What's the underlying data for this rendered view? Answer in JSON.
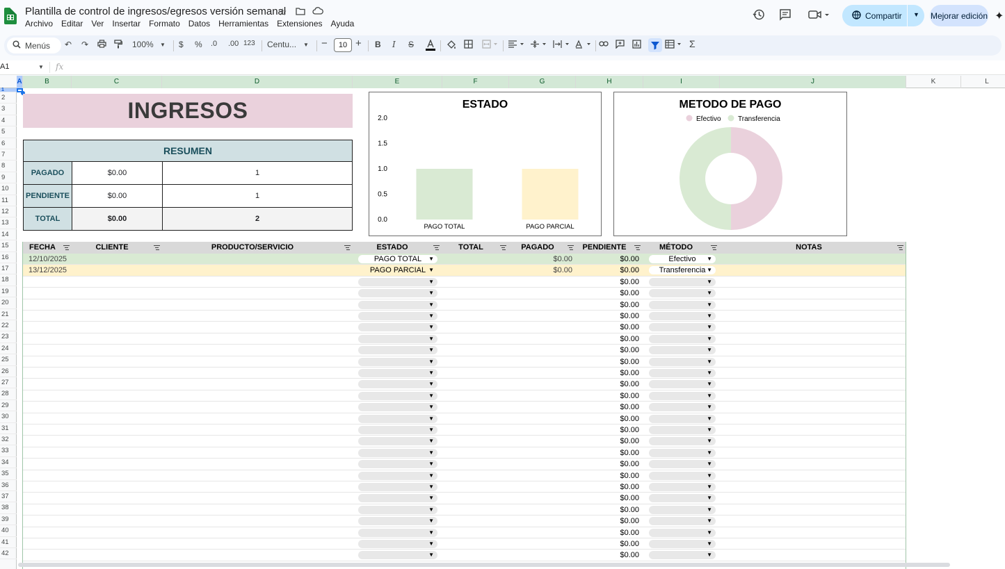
{
  "document": {
    "title": "Plantilla de control de ingresos/egresos versión semanal",
    "menu": [
      "Archivo",
      "Editar",
      "Ver",
      "Insertar",
      "Formato",
      "Datos",
      "Herramientas",
      "Extensiones",
      "Ayuda"
    ],
    "share_label": "Compartir",
    "upgrade_label": "Mejorar edición"
  },
  "toolbar": {
    "search_label": "Menús",
    "zoom": "100%",
    "currency": "$",
    "percent": "%",
    "decimal_less": ".0",
    "decimal_more": ".00",
    "number_format": "123",
    "font": "Centu...",
    "font_size": "10"
  },
  "formula_bar": {
    "cell_ref": "A1",
    "fx": "fx"
  },
  "columns": [
    "A",
    "B",
    "C",
    "D",
    "E",
    "F",
    "G",
    "H",
    "I",
    "J",
    "K",
    "L"
  ],
  "rows": [
    "1",
    "2",
    "3",
    "4",
    "5",
    "6",
    "7",
    "8",
    "9",
    "10",
    "11",
    "12",
    "13",
    "14",
    "15",
    "16",
    "17",
    "18",
    "19",
    "20",
    "21",
    "22",
    "23",
    "24",
    "25",
    "26",
    "27",
    "28",
    "29",
    "30",
    "31",
    "32",
    "33",
    "34",
    "35",
    "36",
    "37",
    "38",
    "39",
    "40",
    "41",
    "42"
  ],
  "sheet": {
    "banner": "INGRESOS",
    "resumen": {
      "title": "RESUMEN",
      "rows": [
        {
          "label": "PAGADO",
          "amount": "$0.00",
          "count": "1"
        },
        {
          "label": "PENDIENTE",
          "amount": "$0.00",
          "count": "1"
        },
        {
          "label": "TOTAL",
          "amount": "$0.00",
          "count": "2"
        }
      ]
    },
    "table": {
      "headers": [
        "FECHA",
        "CLIENTE",
        "PRODUCTO/SERVICIO",
        "ESTADO",
        "TOTAL",
        "PAGADO",
        "PENDIENTE",
        "MÉTODO",
        "NOTAS"
      ],
      "rows": [
        {
          "fecha": "12/10/2025",
          "estado": "PAGO TOTAL",
          "pagado": "$0.00",
          "pendiente": "$0.00",
          "metodo": "Efectivo"
        },
        {
          "fecha": "13/12/2025",
          "estado": "PAGO PARCIAL",
          "pagado": "$0.00",
          "pendiente": "$0.00",
          "metodo": "Transferencia"
        }
      ],
      "empty_pendiente": "$0.00"
    }
  },
  "chart_data": [
    {
      "type": "bar",
      "title": "ESTADO",
      "categories": [
        "PAGO TOTAL",
        "PAGO PARCIAL"
      ],
      "values": [
        1,
        1
      ],
      "colors": [
        "#d9ead3",
        "#fff2cc"
      ],
      "ylim": [
        0,
        2
      ],
      "yticks": [
        "0.0",
        "0.5",
        "1.0",
        "1.5",
        "2.0"
      ],
      "xlabel": "",
      "ylabel": "",
      "grid": false
    },
    {
      "type": "pie",
      "title": "METODO DE PAGO",
      "labels": [
        "Efectivo",
        "Transferencia"
      ],
      "values": [
        1,
        1
      ],
      "colors": [
        "#ead1dc",
        "#d9ead3"
      ],
      "donut": true,
      "legend": "top"
    }
  ]
}
